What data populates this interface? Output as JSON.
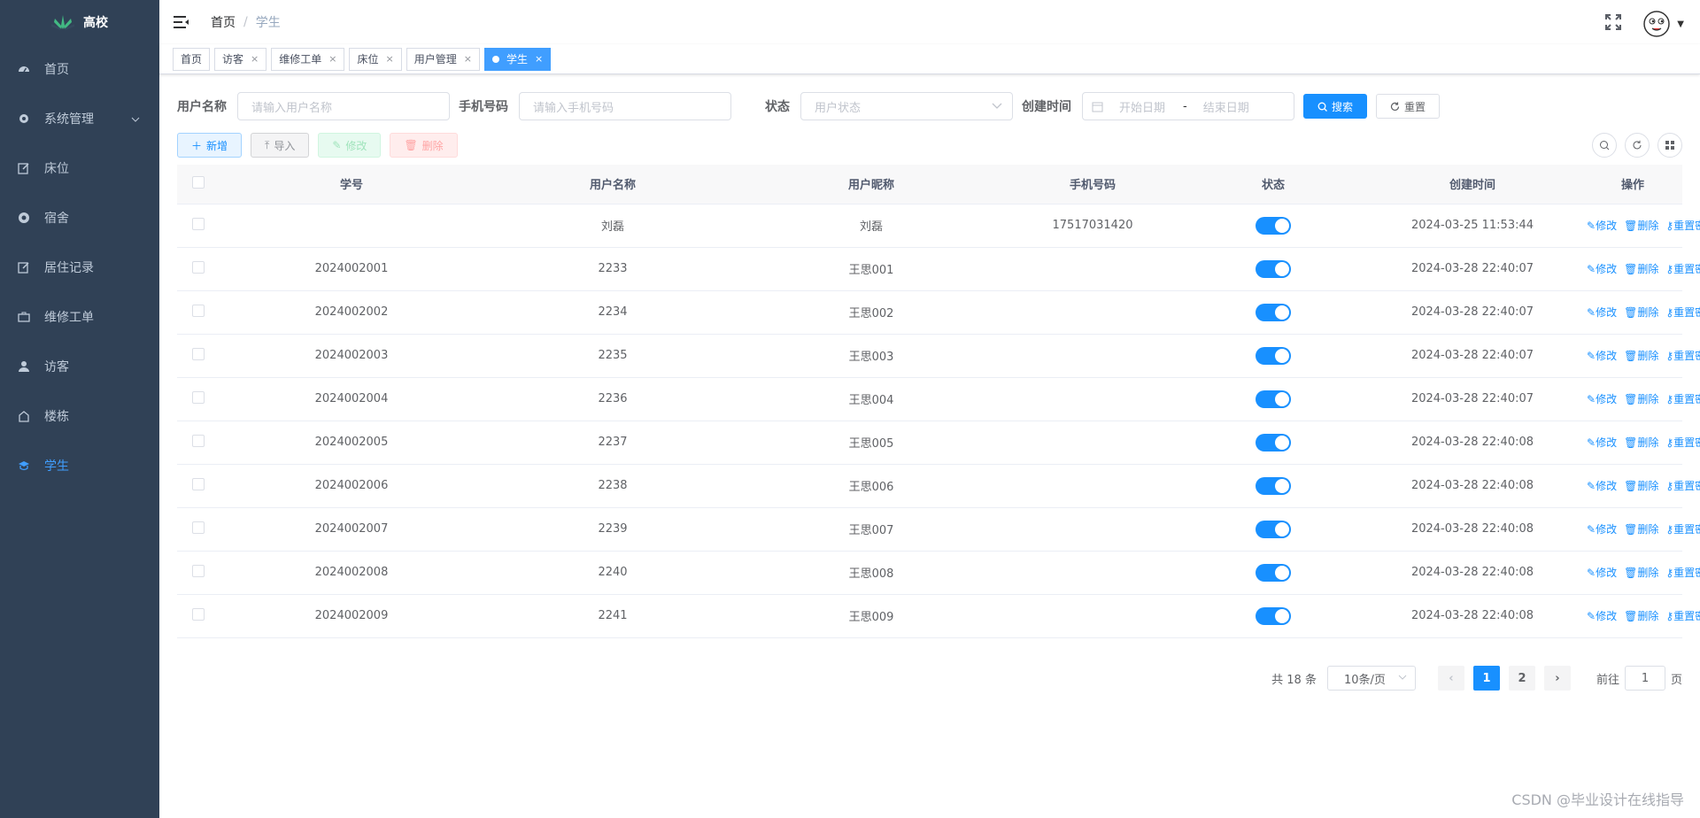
{
  "sidebar": {
    "logo_text": "高校",
    "items": [
      {
        "label": "首页",
        "icon": "dashboard-icon"
      },
      {
        "label": "系统管理",
        "icon": "gear-icon"
      },
      {
        "label": "床位",
        "icon": "edit-icon"
      },
      {
        "label": "宿舍",
        "icon": "lifebuoy-icon"
      },
      {
        "label": "居住记录",
        "icon": "edit-icon"
      },
      {
        "label": "维修工单",
        "icon": "toolbox-icon"
      },
      {
        "label": "访客",
        "icon": "user-icon"
      },
      {
        "label": "楼栋",
        "icon": "building-icon"
      },
      {
        "label": "学生",
        "icon": "student-icon"
      }
    ],
    "active_color": "#409eff"
  },
  "navbar": {
    "breadcrumb": [
      "首页",
      "学生"
    ]
  },
  "tags": [
    {
      "label": "首页"
    },
    {
      "label": "访客"
    },
    {
      "label": "维修工单"
    },
    {
      "label": "床位"
    },
    {
      "label": "用户管理"
    },
    {
      "label": "学生"
    }
  ],
  "search": {
    "username_label": "用户名称",
    "username_placeholder": "请输入用户名称",
    "phone_label": "手机号码",
    "phone_placeholder": "请输入手机号码",
    "status_label": "状态",
    "status_placeholder": "用户状态",
    "created_label": "创建时间",
    "start_placeholder": "开始日期",
    "date_sep": "-",
    "end_placeholder": "结束日期",
    "search_btn": "搜索",
    "reset_btn": "重置"
  },
  "toolbar": {
    "add": "新增",
    "import": "导入",
    "edit": "修改",
    "delete": "删除"
  },
  "table": {
    "headers": [
      "学号",
      "用户名称",
      "用户昵称",
      "手机号码",
      "状态",
      "创建时间",
      "操作"
    ],
    "rows": [
      {
        "sid": "",
        "username": "刘磊",
        "nickname": "刘磊",
        "phone": "17517031420",
        "created": "2024-03-25 11:53:44"
      },
      {
        "sid": "2024002001",
        "username": "2233",
        "nickname": "王思001",
        "phone": "",
        "created": "2024-03-28 22:40:07"
      },
      {
        "sid": "2024002002",
        "username": "2234",
        "nickname": "王思002",
        "phone": "",
        "created": "2024-03-28 22:40:07"
      },
      {
        "sid": "2024002003",
        "username": "2235",
        "nickname": "王思003",
        "phone": "",
        "created": "2024-03-28 22:40:07"
      },
      {
        "sid": "2024002004",
        "username": "2236",
        "nickname": "王思004",
        "phone": "",
        "created": "2024-03-28 22:40:07"
      },
      {
        "sid": "2024002005",
        "username": "2237",
        "nickname": "王思005",
        "phone": "",
        "created": "2024-03-28 22:40:08"
      },
      {
        "sid": "2024002006",
        "username": "2238",
        "nickname": "王思006",
        "phone": "",
        "created": "2024-03-28 22:40:08"
      },
      {
        "sid": "2024002007",
        "username": "2239",
        "nickname": "王思007",
        "phone": "",
        "created": "2024-03-28 22:40:08"
      },
      {
        "sid": "2024002008",
        "username": "2240",
        "nickname": "王思008",
        "phone": "",
        "created": "2024-03-28 22:40:08"
      },
      {
        "sid": "2024002009",
        "username": "2241",
        "nickname": "王思009",
        "phone": "",
        "created": "2024-03-28 22:40:08"
      }
    ],
    "op_edit": "修改",
    "op_delete": "删除",
    "op_reset": "重置密码"
  },
  "pagination": {
    "total": "共 18 条",
    "page_size": "10条/页",
    "pages": [
      "1",
      "2"
    ],
    "current": "1",
    "goto_label": "前往",
    "goto_value": "1",
    "goto_unit": "页"
  },
  "watermark": "CSDN @毕业设计在线指导"
}
